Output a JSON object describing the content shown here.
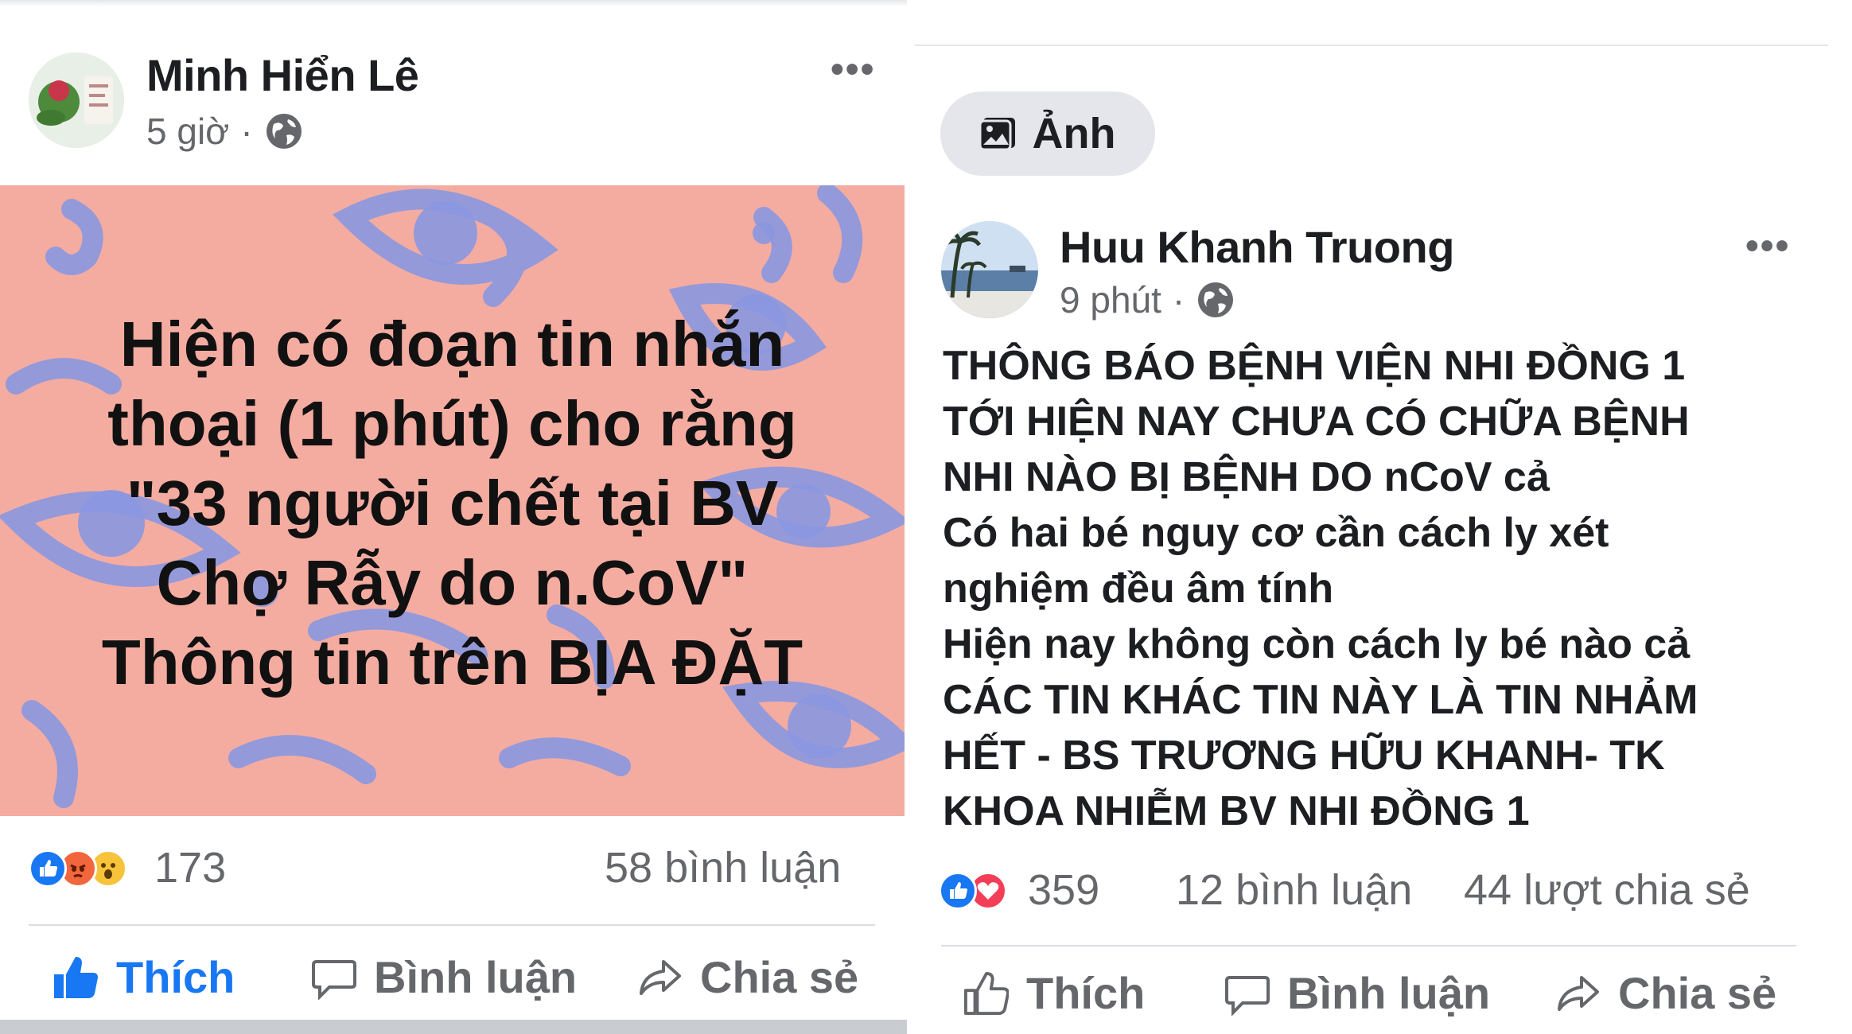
{
  "left_post": {
    "author": "Minh Hiển Lê",
    "time": "5 giờ",
    "separator": "·",
    "card_text": "Hiện có đoạn tin nhắn\nthoại  (1 phút) cho rằng\n\"33 người chết tại BV\nChợ Rẫy do n.CoV\"\nThông tin trên BỊA ĐẶT",
    "card_color": "#f4aca1",
    "reactions": [
      "like",
      "angry",
      "wow"
    ],
    "reaction_count": "173",
    "comments": "58 bình luận",
    "actions": {
      "like": "Thích",
      "comment": "Bình luận",
      "share": "Chia sẻ"
    },
    "like_color": "#1877f2"
  },
  "right_post": {
    "chip_label": "Ảnh",
    "author": "Huu Khanh Truong",
    "time": "9 phút",
    "separator": "·",
    "text_lines": [
      "THÔNG BÁO BỆNH VIỆN NHI ĐỒNG 1",
      "TỚI HIỆN NAY CHƯA CÓ CHỮA BỆNH",
      "NHI NÀO BỊ BỆNH DO nCoV cả",
      "Có hai bé nguy cơ cần cách ly xét",
      "nghiệm đều âm tính",
      "Hiện nay không còn cách ly bé nào cả",
      "CÁC TIN KHÁC TIN NÀY LÀ TIN NHẢM",
      "HẾT - BS TRƯƠNG HỮU KHANH- TK",
      "KHOA NHIỄM BV NHI ĐỒNG 1"
    ],
    "reactions": [
      "like",
      "love"
    ],
    "reaction_count": "359",
    "comments": "12 bình luận",
    "shares": "44 lượt chia sẻ",
    "actions": {
      "like": "Thích",
      "comment": "Bình luận",
      "share": "Chia sẻ"
    }
  }
}
